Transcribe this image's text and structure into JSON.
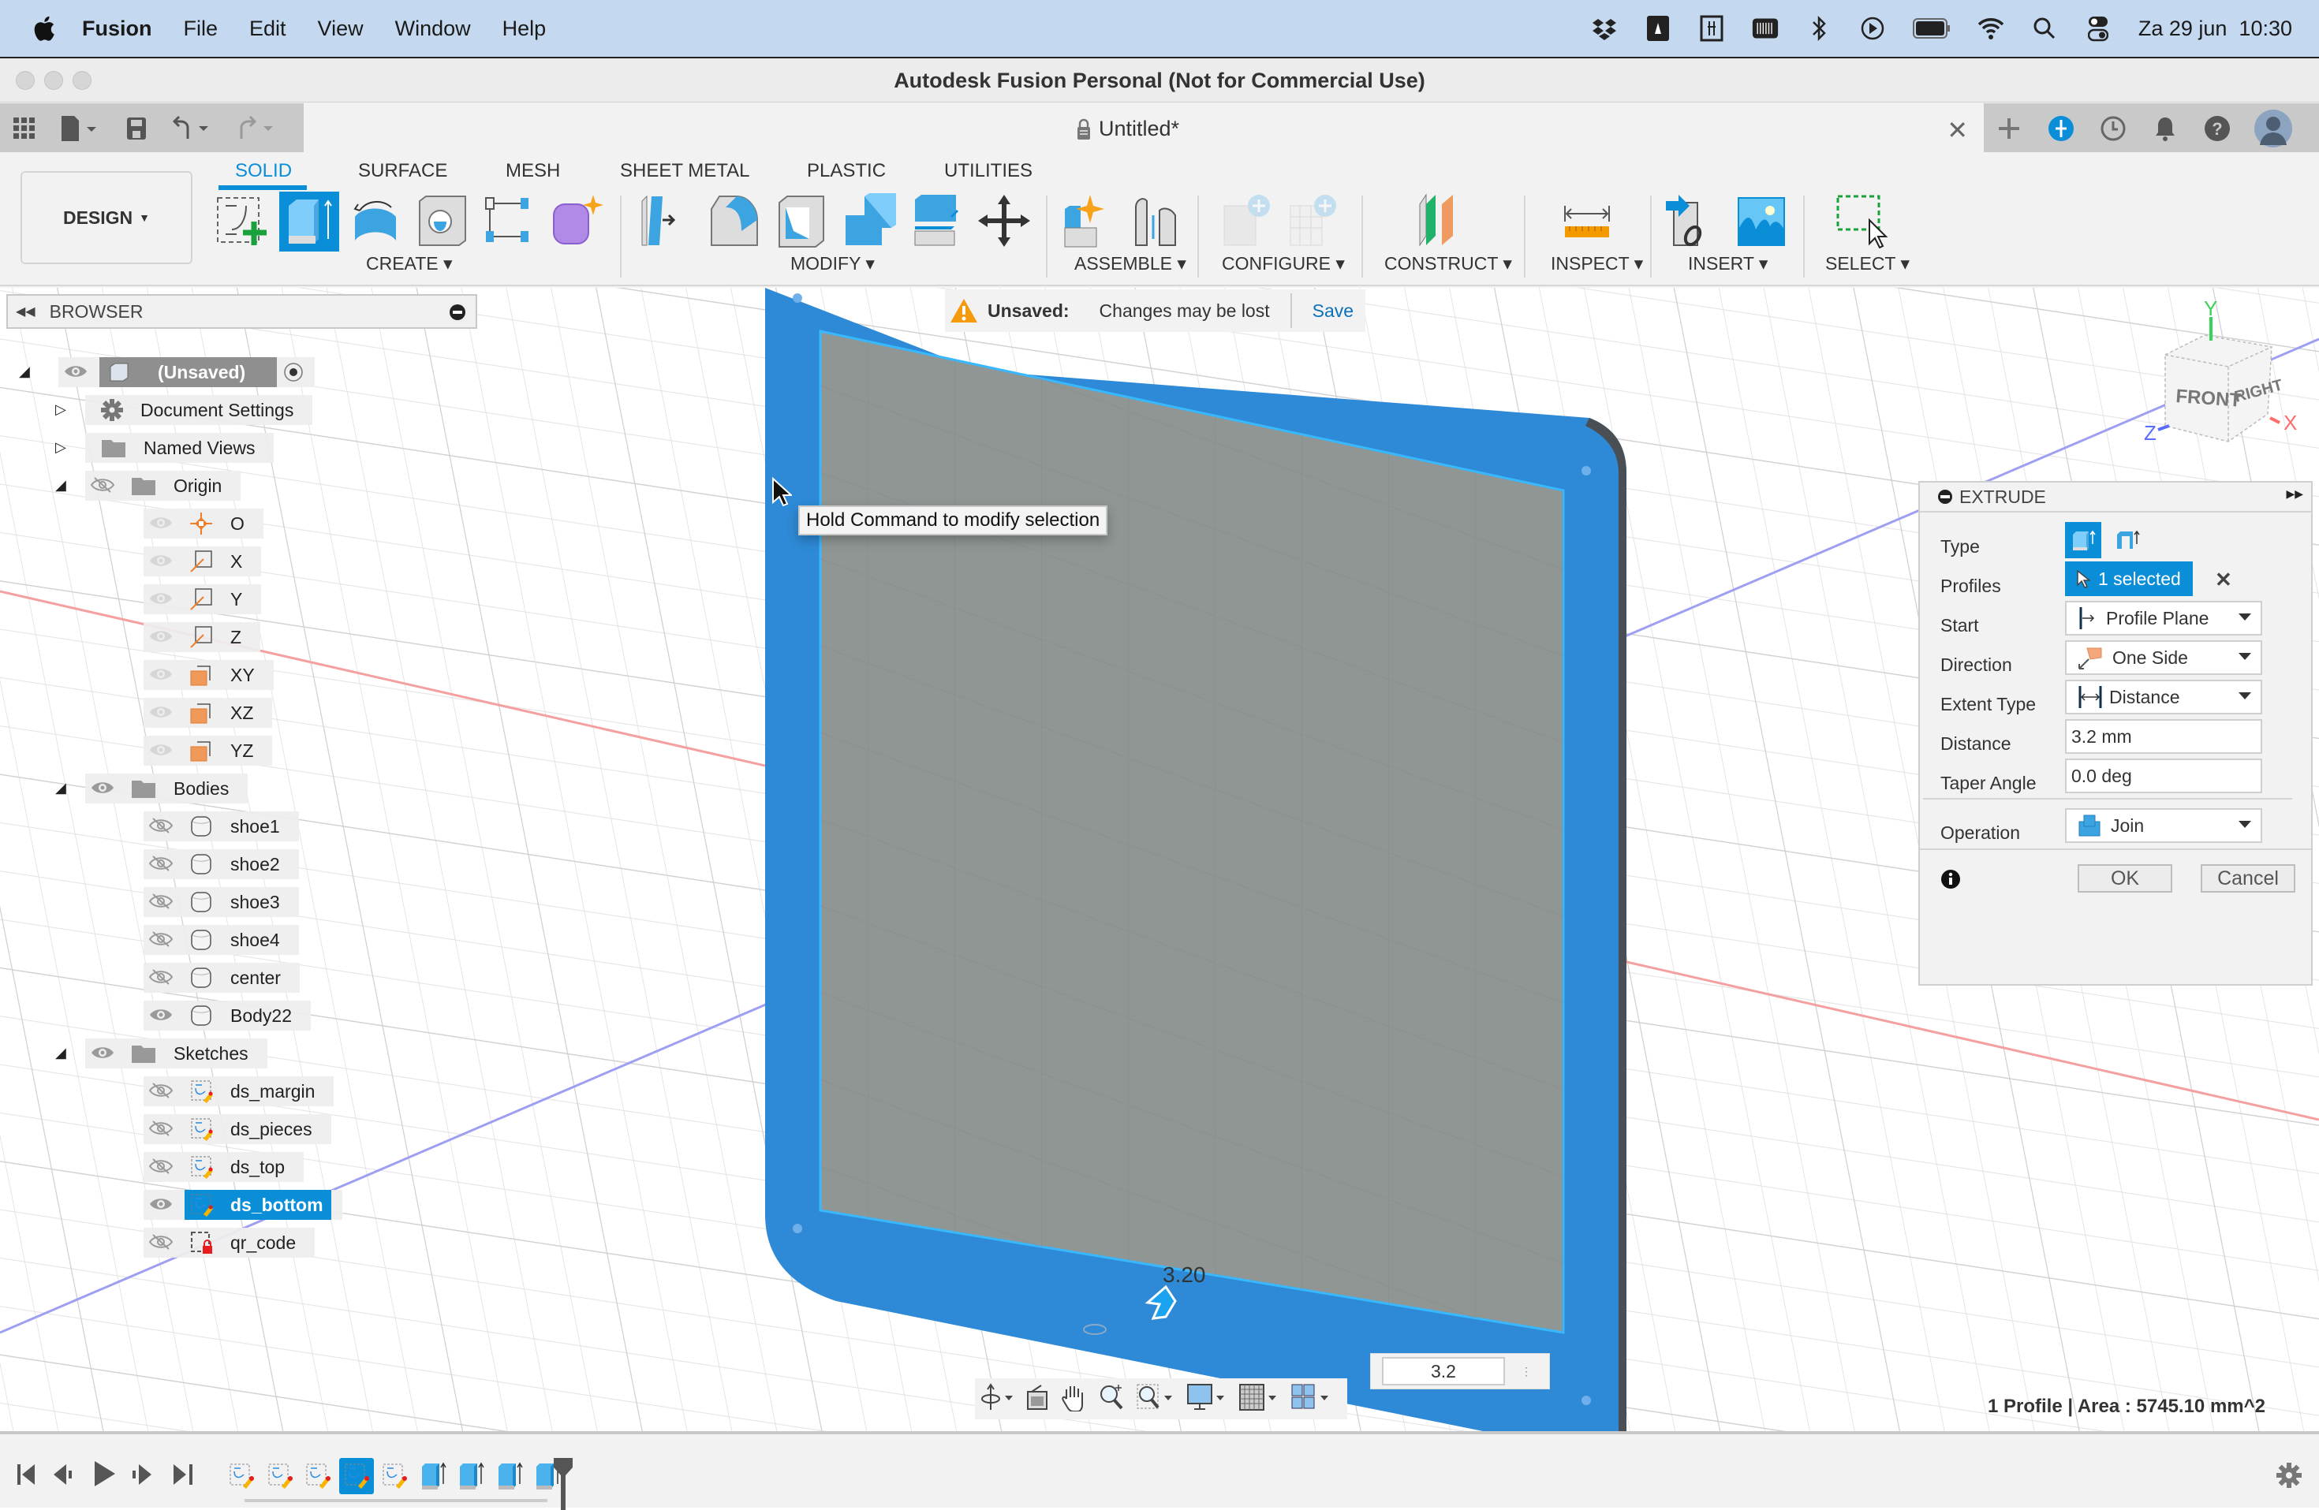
{
  "menubar": {
    "app_name": "Fusion",
    "items": [
      "File",
      "Edit",
      "View",
      "Window",
      "Help"
    ],
    "tray_icons": [
      "dropbox-icon",
      "autodesk-icon",
      "calendar-icon",
      "keyboard-icon",
      "bluetooth-icon",
      "play-icon",
      "battery-icon",
      "wifi-icon",
      "spotlight-icon",
      "control-center-icon"
    ],
    "datetime": "Za 29 jun  10:30"
  },
  "window": {
    "title": "Autodesk Fusion Personal (Not for Commercial Use)",
    "doc_tab": "Untitled*"
  },
  "ribbon": {
    "workspace": "DESIGN",
    "tabs": [
      {
        "label": "SOLID",
        "active": true
      },
      {
        "label": "SURFACE",
        "active": false
      },
      {
        "label": "MESH",
        "active": false
      },
      {
        "label": "SHEET METAL",
        "active": false
      },
      {
        "label": "PLASTIC",
        "active": false
      },
      {
        "label": "UTILITIES",
        "active": false
      }
    ],
    "groups": [
      "CREATE",
      "MODIFY",
      "ASSEMBLE",
      "CONFIGURE",
      "CONSTRUCT",
      "INSPECT",
      "INSERT",
      "SELECT"
    ],
    "create_tools": [
      "create-sketch",
      "extrude",
      "revolve",
      "hole",
      "pattern",
      "create-form"
    ],
    "modify_tools": [
      "press-pull",
      "fillet",
      "shell",
      "combine",
      "offset-face",
      "move-copy"
    ],
    "assemble_tools": [
      "new-component",
      "joint"
    ],
    "configure_tools": [
      "configure-a",
      "configure-b"
    ],
    "construct_tools": [
      "offset-plane"
    ],
    "inspect_tools": [
      "measure"
    ],
    "insert_tools": [
      "insert-derive",
      "insert-canvas"
    ],
    "select_tools": [
      "window-select"
    ]
  },
  "notice": {
    "label": "Unsaved:",
    "message": "Changes may be lost",
    "action": "Save"
  },
  "tooltip": "Hold Command to modify selection",
  "browser": {
    "title": "BROWSER",
    "root": "(Unsaved)",
    "items": [
      {
        "label": "Document Settings",
        "level": 1,
        "icon": "gear",
        "expand": "collapsed"
      },
      {
        "label": "Named Views",
        "level": 1,
        "icon": "folder",
        "expand": "collapsed"
      },
      {
        "label": "Origin",
        "level": 1,
        "icon": "folder",
        "expand": "expanded",
        "visible": false
      },
      {
        "label": "O",
        "level": 2,
        "icon": "origin-point"
      },
      {
        "label": "X",
        "level": 2,
        "icon": "axis"
      },
      {
        "label": "Y",
        "level": 2,
        "icon": "axis"
      },
      {
        "label": "Z",
        "level": 2,
        "icon": "axis"
      },
      {
        "label": "XY",
        "level": 2,
        "icon": "plane"
      },
      {
        "label": "XZ",
        "level": 2,
        "icon": "plane"
      },
      {
        "label": "YZ",
        "level": 2,
        "icon": "plane"
      },
      {
        "label": "Bodies",
        "level": 1,
        "icon": "folder",
        "expand": "expanded",
        "visible": true
      },
      {
        "label": "shoe1",
        "level": 2,
        "icon": "body",
        "visible": false
      },
      {
        "label": "shoe2",
        "level": 2,
        "icon": "body",
        "visible": false
      },
      {
        "label": "shoe3",
        "level": 2,
        "icon": "body",
        "visible": false
      },
      {
        "label": "shoe4",
        "level": 2,
        "icon": "body",
        "visible": false
      },
      {
        "label": "center",
        "level": 2,
        "icon": "body",
        "visible": false
      },
      {
        "label": "Body22",
        "level": 2,
        "icon": "body",
        "visible": true
      },
      {
        "label": "Sketches",
        "level": 1,
        "icon": "folder",
        "expand": "expanded",
        "visible": true
      },
      {
        "label": "ds_margin",
        "level": 2,
        "icon": "sketch",
        "visible": false
      },
      {
        "label": "ds_pieces",
        "level": 2,
        "icon": "sketch",
        "visible": false
      },
      {
        "label": "ds_top",
        "level": 2,
        "icon": "sketch",
        "visible": false
      },
      {
        "label": "ds_bottom",
        "level": 2,
        "icon": "sketch",
        "visible": true,
        "selected": true
      },
      {
        "label": "qr_code",
        "level": 2,
        "icon": "sketch-locked",
        "visible": false
      }
    ]
  },
  "viewcube": {
    "front": "FRONT",
    "right": "RIGHT",
    "x": "X",
    "y": "Y",
    "z": "Z"
  },
  "extrude": {
    "title": "EXTRUDE",
    "rows": {
      "type_label": "Type",
      "profiles_label": "Profiles",
      "profiles_value": "1 selected",
      "start_label": "Start",
      "start_value": "Profile Plane",
      "direction_label": "Direction",
      "direction_value": "One Side",
      "extent_label": "Extent Type",
      "extent_value": "Distance",
      "distance_label": "Distance",
      "distance_value": "3.2 mm",
      "taper_label": "Taper Angle",
      "taper_value": "0.0 deg",
      "operation_label": "Operation",
      "operation_value": "Join"
    },
    "ok": "OK",
    "cancel": "Cancel"
  },
  "manipulator": {
    "dimension_label": "3.20",
    "input_value": "3.2"
  },
  "nav_bar": [
    "orbit",
    "look-at",
    "pan",
    "zoom",
    "fit",
    "display-settings",
    "grid-settings",
    "viewports"
  ],
  "status": "1 Profile | Area : 5745.10 mm^2",
  "timeline": {
    "controls": [
      "first",
      "previous",
      "play",
      "next",
      "last"
    ],
    "items": [
      {
        "type": "sketch",
        "selected": false
      },
      {
        "type": "sketch",
        "selected": false
      },
      {
        "type": "sketch",
        "selected": false
      },
      {
        "type": "sketch",
        "selected": true
      },
      {
        "type": "sketch",
        "selected": false
      },
      {
        "type": "extrude",
        "selected": false
      },
      {
        "type": "extrude",
        "selected": false
      },
      {
        "type": "extrude",
        "selected": false
      },
      {
        "type": "extrude",
        "selected": false
      }
    ]
  },
  "colors": {
    "accent": "#0b8ed8",
    "body_blue": "#2e8ad6",
    "profile_gray": "#8f9694",
    "menubar": "#c4d9f0",
    "warning": "#f59a0c"
  }
}
